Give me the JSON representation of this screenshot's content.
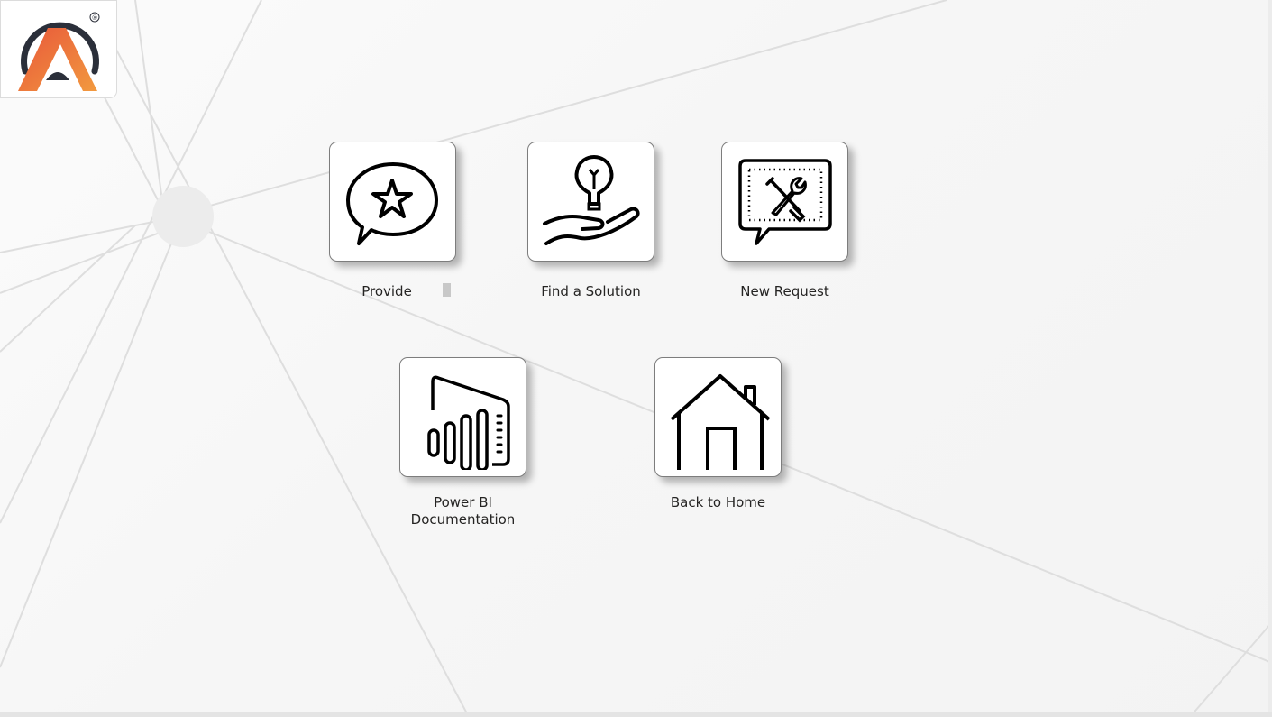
{
  "logo": {
    "registered_mark": "®",
    "colors": {
      "ring": "#2b2f3a",
      "gradient_start": "#e8573a",
      "gradient_end": "#f08a3c"
    }
  },
  "tiles": {
    "provide": {
      "label": "Provide",
      "icon": "speech-bubble-star-icon"
    },
    "find_solution": {
      "label": "Find a Solution",
      "icon": "lightbulb-hand-icon"
    },
    "new_request": {
      "label": "New Request",
      "icon": "tools-speech-bubble-icon"
    },
    "power_bi": {
      "label_line1": "Power BI",
      "label_line2": "Documentation",
      "icon": "power-bi-icon"
    },
    "back_home": {
      "label": "Back to Home",
      "icon": "house-icon"
    }
  }
}
